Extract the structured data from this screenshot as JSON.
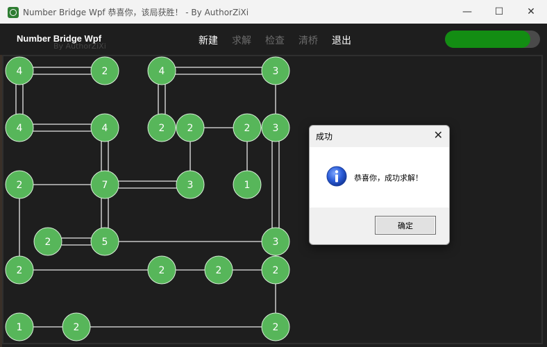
{
  "window": {
    "title": "Number Bridge Wpf 恭喜你，该局获胜！ - By AuthorZiXi",
    "minimize": "—",
    "maximize": "☐",
    "close": "✕"
  },
  "header": {
    "app_name": "Number Bridge Wpf",
    "author": "By AuthorZiXi",
    "menu": [
      {
        "label": "新建",
        "enabled": true
      },
      {
        "label": "求解",
        "enabled": false
      },
      {
        "label": "检查",
        "enabled": false
      },
      {
        "label": "清桥",
        "enabled": false
      },
      {
        "label": "退出",
        "enabled": true
      }
    ],
    "progress": 0.9
  },
  "colors": {
    "node_fill": "#57b65a",
    "node_stroke": "#d8eed8",
    "bridge": "#e8e8e8",
    "progress_fill": "#138d13",
    "info_blue": "#2a5bd7"
  },
  "puzzle": {
    "nodes": [
      {
        "id": "a",
        "col": 0,
        "row": 0,
        "value": "4"
      },
      {
        "id": "b",
        "col": 3,
        "row": 0,
        "value": "2"
      },
      {
        "id": "c",
        "col": 5,
        "row": 0,
        "value": "4"
      },
      {
        "id": "d",
        "col": 9,
        "row": 0,
        "value": "3"
      },
      {
        "id": "e",
        "col": 0,
        "row": 2,
        "value": "4"
      },
      {
        "id": "f",
        "col": 3,
        "row": 2,
        "value": "4"
      },
      {
        "id": "g",
        "col": 5,
        "row": 2,
        "value": "2"
      },
      {
        "id": "h",
        "col": 6,
        "row": 2,
        "value": "2"
      },
      {
        "id": "i",
        "col": 8,
        "row": 2,
        "value": "2"
      },
      {
        "id": "j",
        "col": 9,
        "row": 2,
        "value": "3"
      },
      {
        "id": "k",
        "col": 0,
        "row": 4,
        "value": "2"
      },
      {
        "id": "l",
        "col": 3,
        "row": 4,
        "value": "7"
      },
      {
        "id": "m",
        "col": 6,
        "row": 4,
        "value": "3"
      },
      {
        "id": "n",
        "col": 8,
        "row": 4,
        "value": "1"
      },
      {
        "id": "o",
        "col": 1,
        "row": 6,
        "value": "2"
      },
      {
        "id": "p",
        "col": 3,
        "row": 6,
        "value": "5"
      },
      {
        "id": "q",
        "col": 9,
        "row": 6,
        "value": "3"
      },
      {
        "id": "r",
        "col": 0,
        "row": 7,
        "value": "2"
      },
      {
        "id": "s",
        "col": 5,
        "row": 7,
        "value": "2"
      },
      {
        "id": "t",
        "col": 7,
        "row": 7,
        "value": "2"
      },
      {
        "id": "u",
        "col": 9,
        "row": 7,
        "value": "2"
      },
      {
        "id": "v",
        "col": 0,
        "row": 9,
        "value": "1"
      },
      {
        "id": "w",
        "col": 2,
        "row": 9,
        "value": "2"
      },
      {
        "id": "x",
        "col": 9,
        "row": 9,
        "value": "2"
      }
    ],
    "bridges": [
      {
        "from": "a",
        "to": "b",
        "count": 2
      },
      {
        "from": "a",
        "to": "e",
        "count": 2
      },
      {
        "from": "c",
        "to": "d",
        "count": 2
      },
      {
        "from": "c",
        "to": "g",
        "count": 2
      },
      {
        "from": "d",
        "to": "j",
        "count": 1
      },
      {
        "from": "e",
        "to": "f",
        "count": 2
      },
      {
        "from": "f",
        "to": "l",
        "count": 2
      },
      {
        "from": "h",
        "to": "i",
        "count": 1
      },
      {
        "from": "h",
        "to": "m",
        "count": 1
      },
      {
        "from": "i",
        "to": "n",
        "count": 1
      },
      {
        "from": "j",
        "to": "q",
        "count": 2
      },
      {
        "from": "k",
        "to": "l",
        "count": 1
      },
      {
        "from": "k",
        "to": "r",
        "count": 1
      },
      {
        "from": "l",
        "to": "m",
        "count": 2
      },
      {
        "from": "l",
        "to": "p",
        "count": 2
      },
      {
        "from": "o",
        "to": "p",
        "count": 2
      },
      {
        "from": "p",
        "to": "q",
        "count": 1
      },
      {
        "from": "r",
        "to": "s",
        "count": 1
      },
      {
        "from": "s",
        "to": "t",
        "count": 1
      },
      {
        "from": "t",
        "to": "u",
        "count": 1
      },
      {
        "from": "u",
        "to": "x",
        "count": 1
      },
      {
        "from": "v",
        "to": "w",
        "count": 1
      },
      {
        "from": "w",
        "to": "x",
        "count": 1
      }
    ]
  },
  "dialog": {
    "title": "成功",
    "message": "恭喜你，成功求解！",
    "ok_label": "确定",
    "close": "✕",
    "icon": "info-icon"
  }
}
